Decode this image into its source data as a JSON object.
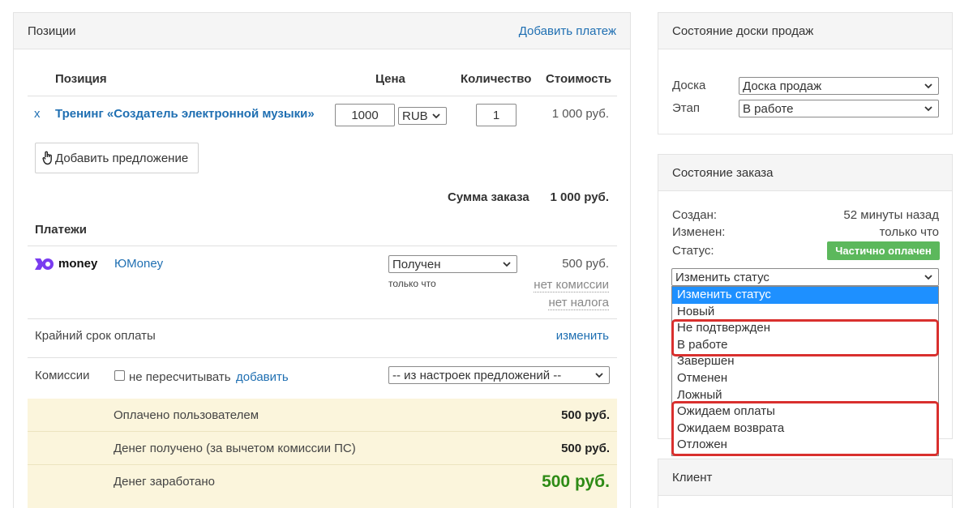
{
  "left_panel": {
    "title": "Позиции",
    "add_payment_link": "Добавить платеж",
    "columns": {
      "position": "Позиция",
      "price": "Цена",
      "quantity": "Количество",
      "cost": "Стоимость"
    },
    "item": {
      "remove": "x",
      "name": "Тренинг «Создатель электронной музыки»",
      "price": "1000",
      "currency": "RUB",
      "quantity": "1",
      "cost": "1 000 руб."
    },
    "add_offer_button": "Добавить предложение",
    "order_sum_label": "Сумма заказа",
    "order_sum_value": "1 000 руб.",
    "payments_title": "Платежи",
    "payment": {
      "logo_text": "money",
      "provider_link": "ЮMoney",
      "status_select": "Получен",
      "time": "только что",
      "amount": "500 руб.",
      "commission_link": "нет комиссии",
      "tax_link": "нет налога"
    },
    "deadline_label": "Крайний срок оплаты",
    "deadline_change_link": "изменить",
    "commissions_label": "Комиссии",
    "no_recalc_label": "не пересчитывать",
    "add_commission_link": "добавить",
    "commission_source_select": "-- из настроек предложений --",
    "summary": [
      {
        "label": "Оплачено пользователем",
        "value": "500 руб."
      },
      {
        "label": "Денег получено (за вычетом комиссии ПС)",
        "value": "500 руб."
      },
      {
        "label": "Денег заработано",
        "value": "500 руб."
      }
    ]
  },
  "board_panel": {
    "title": "Состояние доски продаж",
    "board_label": "Доска",
    "board_value": "Доска продаж",
    "stage_label": "Этап",
    "stage_value": "В работе"
  },
  "order_panel": {
    "title": "Состояние заказа",
    "created_label": "Создан:",
    "created_value": "52 минуты назад",
    "changed_label": "Изменен:",
    "changed_value": "только что",
    "status_label": "Статус:",
    "status_badge": "Частично оплачен",
    "change_status_select": "Изменить статус",
    "status_options": [
      "Изменить статус",
      "Новый",
      "Не подтвержден",
      "В работе",
      "Завершен",
      "Отменен",
      "Ложный",
      "Ожидаем оплаты",
      "Ожидаем возврата",
      "Отложен"
    ]
  },
  "client_panel": {
    "title": "Клиент"
  },
  "colors": {
    "link": "#1f6fb2",
    "badge_green": "#5cb85c",
    "summary_bg": "#fbf5dc",
    "earned_green": "#2e8b16",
    "highlight_red": "#d9302e",
    "dropdown_selected": "#1e90ff"
  }
}
